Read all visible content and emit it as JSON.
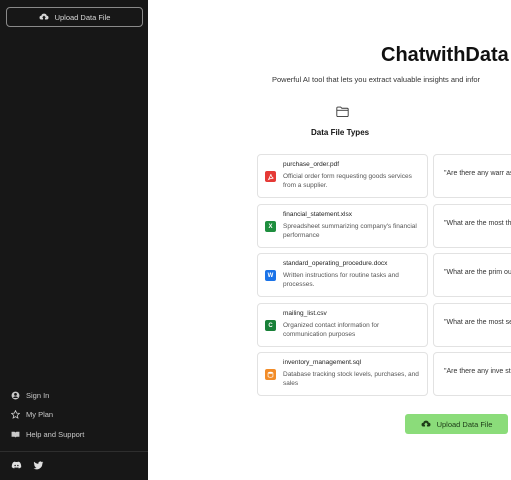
{
  "sidebar": {
    "upload_label": "Upload Data File",
    "links": [
      {
        "label": "Sign In",
        "icon": "user-circle-icon"
      },
      {
        "label": "My Plan",
        "icon": "star-badge-icon"
      },
      {
        "label": "Help and Support",
        "icon": "book-icon"
      }
    ],
    "social": [
      "discord-icon",
      "twitter-icon"
    ]
  },
  "main": {
    "title": "ChatwithData",
    "subtitle": "Powerful AI tool that lets you extract valuable insights and infor",
    "section_title": "Data File Types",
    "files": [
      {
        "name": "purchase_order.pdf",
        "description": "Official order form requesting goods services from a supplier.",
        "badge": "PDF",
        "color": "#e53935"
      },
      {
        "name": "financial_statement.xlsx",
        "description": "Spreadsheet summarizing company's financial performance",
        "badge": "X",
        "color": "#1e8e3e"
      },
      {
        "name": "standard_operating_procedure.docx",
        "description": "Written instructions for routine tasks and processes.",
        "badge": "W",
        "color": "#1a73e8"
      },
      {
        "name": "mailing_list.csv",
        "description": "Organized contact information for communication purposes",
        "badge": "C",
        "color": "#188038"
      },
      {
        "name": "inventory_management.sql",
        "description": "Database tracking stock levels, purchases, and sales",
        "badge": "S",
        "color": "#f28c28"
      }
    ],
    "questions": [
      "\"Are there any warr associated with the",
      "\"What are the most they be optimized f",
      "\"What are the prim outlined in the proc",
      "\"What are the most segments in the lis",
      "\"Are there any inve stockouts?\""
    ],
    "upload_label": "Upload Data File"
  },
  "colors": {
    "sidebar_bg": "#171717",
    "upload_button": "#8bdc7a"
  }
}
